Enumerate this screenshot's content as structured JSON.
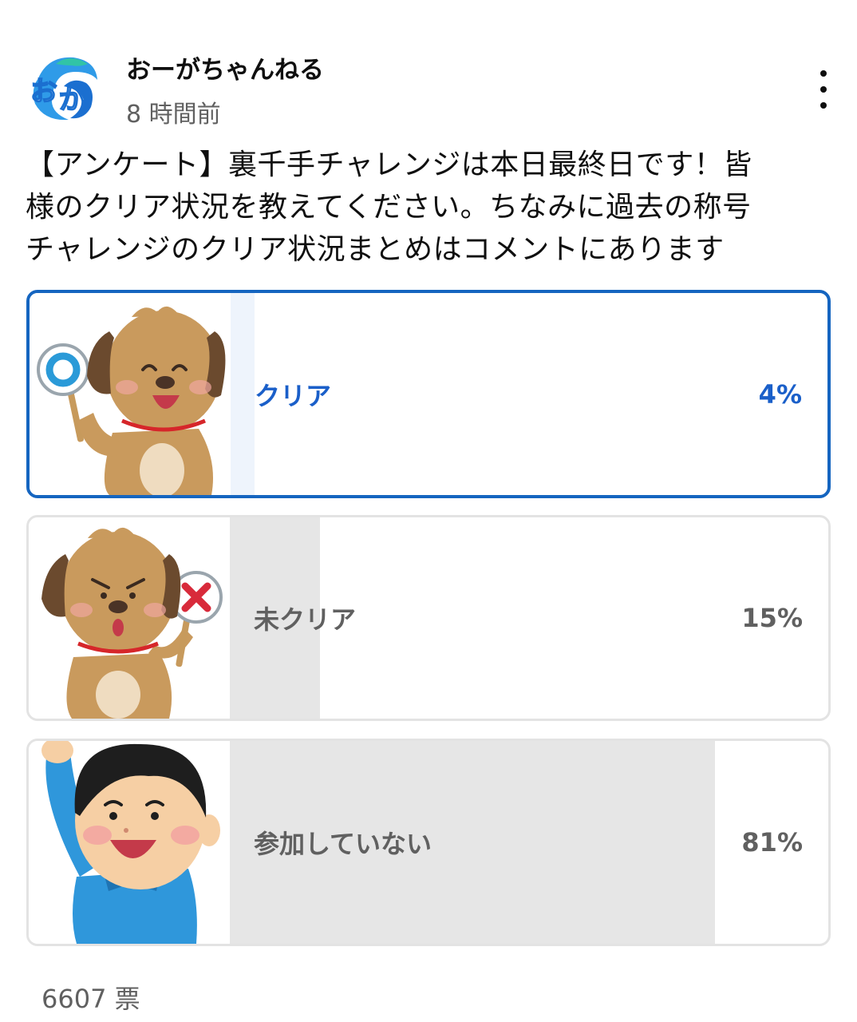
{
  "post": {
    "channel_name": "おーがちゃんねる",
    "time": "8 時間前",
    "avatar_icon": "channel-logo-icon",
    "menu_icon": "more-vertical-icon",
    "text_lines": [
      "【アンケート】裏千手チャレンジは本日最終日です！皆",
      "様のクリア状況を教えてください。ちなみに過去の称号",
      "チャレンジのクリア状況まとめはコメントにあります"
    ]
  },
  "poll": {
    "accent_color": "#1565c0",
    "options": [
      {
        "label": "クリア",
        "percent": "4%",
        "value": 0.04,
        "selected": true,
        "image_icon": "dog-holding-circle-sign-icon"
      },
      {
        "label": "未クリア",
        "percent": "15%",
        "value": 0.15,
        "selected": false,
        "image_icon": "dog-holding-x-sign-icon"
      },
      {
        "label": "参加していない",
        "percent": "81%",
        "value": 0.81,
        "selected": false,
        "image_icon": "boy-raising-hand-icon"
      }
    ],
    "votes": "6607 票"
  }
}
